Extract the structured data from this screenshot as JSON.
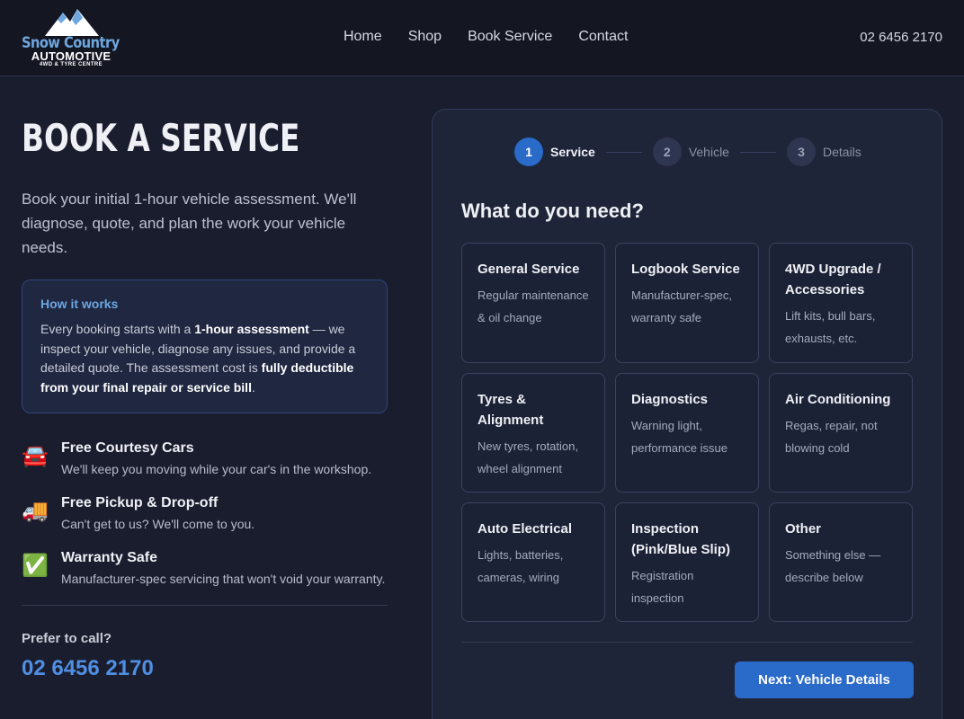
{
  "brand": {
    "line1": "Snow Country",
    "line2": "AUTOMOTIVE",
    "line3": "4WD & TYRE CENTRE"
  },
  "nav": {
    "items": [
      "Home",
      "Shop",
      "Book Service",
      "Contact"
    ]
  },
  "header_phone": "02 6456 2170",
  "hero": {
    "title": "BOOK A SERVICE",
    "intro": "Book your initial 1-hour vehicle assessment. We'll diagnose, quote, and plan the work your vehicle needs."
  },
  "how_it_works": {
    "title": "How it works",
    "text_a": "Every booking starts with a ",
    "bold_a": "1-hour assessment",
    "text_b": " — we inspect your vehicle, diagnose any issues, and provide a detailed quote. The assessment cost is ",
    "bold_b": "fully deductible from your final repair or service bill",
    "text_c": "."
  },
  "features": [
    {
      "icon": "🚘",
      "icon_name": "car-icon",
      "title": "Free Courtesy Cars",
      "desc": "We'll keep you moving while your car's in the workshop."
    },
    {
      "icon": "🚚",
      "icon_name": "truck-icon",
      "title": "Free Pickup & Drop-off",
      "desc": "Can't get to us? We'll come to you."
    },
    {
      "icon": "✅",
      "icon_name": "check-icon",
      "title": "Warranty Safe",
      "desc": "Manufacturer-spec servicing that won't void your warranty."
    }
  ],
  "call": {
    "label": "Prefer to call?",
    "phone": "02 6456 2170"
  },
  "steps": [
    {
      "num": "1",
      "label": "Service"
    },
    {
      "num": "2",
      "label": "Vehicle"
    },
    {
      "num": "3",
      "label": "Details"
    }
  ],
  "active_step": 1,
  "question": "What do you need?",
  "services": [
    {
      "title": "General Service",
      "desc": "Regular maintenance & oil change"
    },
    {
      "title": "Logbook Service",
      "desc": "Manufacturer-spec, warranty safe"
    },
    {
      "title": "4WD Upgrade / Accessories",
      "desc": "Lift kits, bull bars, exhausts, etc."
    },
    {
      "title": "Tyres & Alignment",
      "desc": "New tyres, rotation, wheel alignment"
    },
    {
      "title": "Diagnostics",
      "desc": "Warning light, performance issue"
    },
    {
      "title": "Air Conditioning",
      "desc": "Regas, repair, not blowing cold"
    },
    {
      "title": "Auto Electrical",
      "desc": "Lights, batteries, cameras, wiring"
    },
    {
      "title": "Inspection (Pink/Blue Slip)",
      "desc": "Registration inspection"
    },
    {
      "title": "Other",
      "desc": "Something else — describe below"
    }
  ],
  "next_button": "Next: Vehicle Details",
  "colors": {
    "background": "#1a1d2e",
    "accent": "#2a6ac9",
    "accent_text": "#6ea7e0"
  }
}
